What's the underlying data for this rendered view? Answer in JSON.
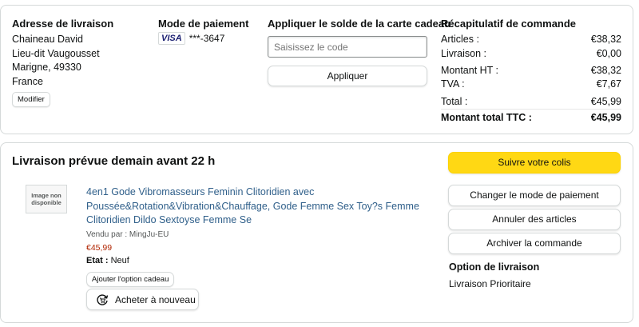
{
  "summary": {
    "address": {
      "heading": "Adresse de livraison",
      "lines": [
        "Chaineau David",
        "Lieu-dit Vaugousset",
        "Marigne, 49330",
        "France"
      ],
      "modify_label": "Modifier"
    },
    "payment": {
      "heading": "Mode de paiement",
      "card_brand": "VISA",
      "card_mask": "***-3647"
    },
    "giftcard": {
      "heading": "Appliquer le solde de la carte cadeau",
      "placeholder": "Saisissez le code",
      "apply_label": "Appliquer"
    },
    "recap": {
      "heading": "Récapitulatif de commande",
      "rows": [
        {
          "label": "Articles :",
          "value": "€38,32"
        },
        {
          "label": "Livraison :",
          "value": "€0,00"
        },
        {
          "label": "Montant HT :",
          "value": "€38,32"
        },
        {
          "label": "TVA :",
          "value": "€7,67"
        },
        {
          "label": "Total :",
          "value": "€45,99"
        }
      ],
      "grand_total": {
        "label": "Montant total TTC :",
        "value": "€45,99"
      }
    }
  },
  "shipment": {
    "heading": "Livraison prévue demain avant 22 h",
    "image_placeholder": "Image non disponible",
    "product_title": "4en1 Gode Vibromasseurs Feminin Clitoridien avec Poussée&Rotation&Vibration&Chauffage, Gode Femme Sex Toy?s Femme Clitoridien Dildo Sextoyse Femme Se",
    "seller": "Vendu par : MingJu-EU",
    "price": "€45,99",
    "state_label": "Etat :",
    "state_value": "Neuf",
    "gift_option_label": "Ajouter l'option cadeau",
    "buy_again_label": "Acheter à nouveau",
    "actions": {
      "track": "Suivre votre colis",
      "change_payment": "Changer le mode de paiement",
      "cancel": "Annuler des articles",
      "archive": "Archiver la commande"
    },
    "delivery_option": {
      "heading": "Option de livraison",
      "value": "Livraison Prioritaire"
    }
  },
  "colors": {
    "primary_button": "#ffd814",
    "price": "#b12704",
    "link": "#2f5f8a"
  }
}
